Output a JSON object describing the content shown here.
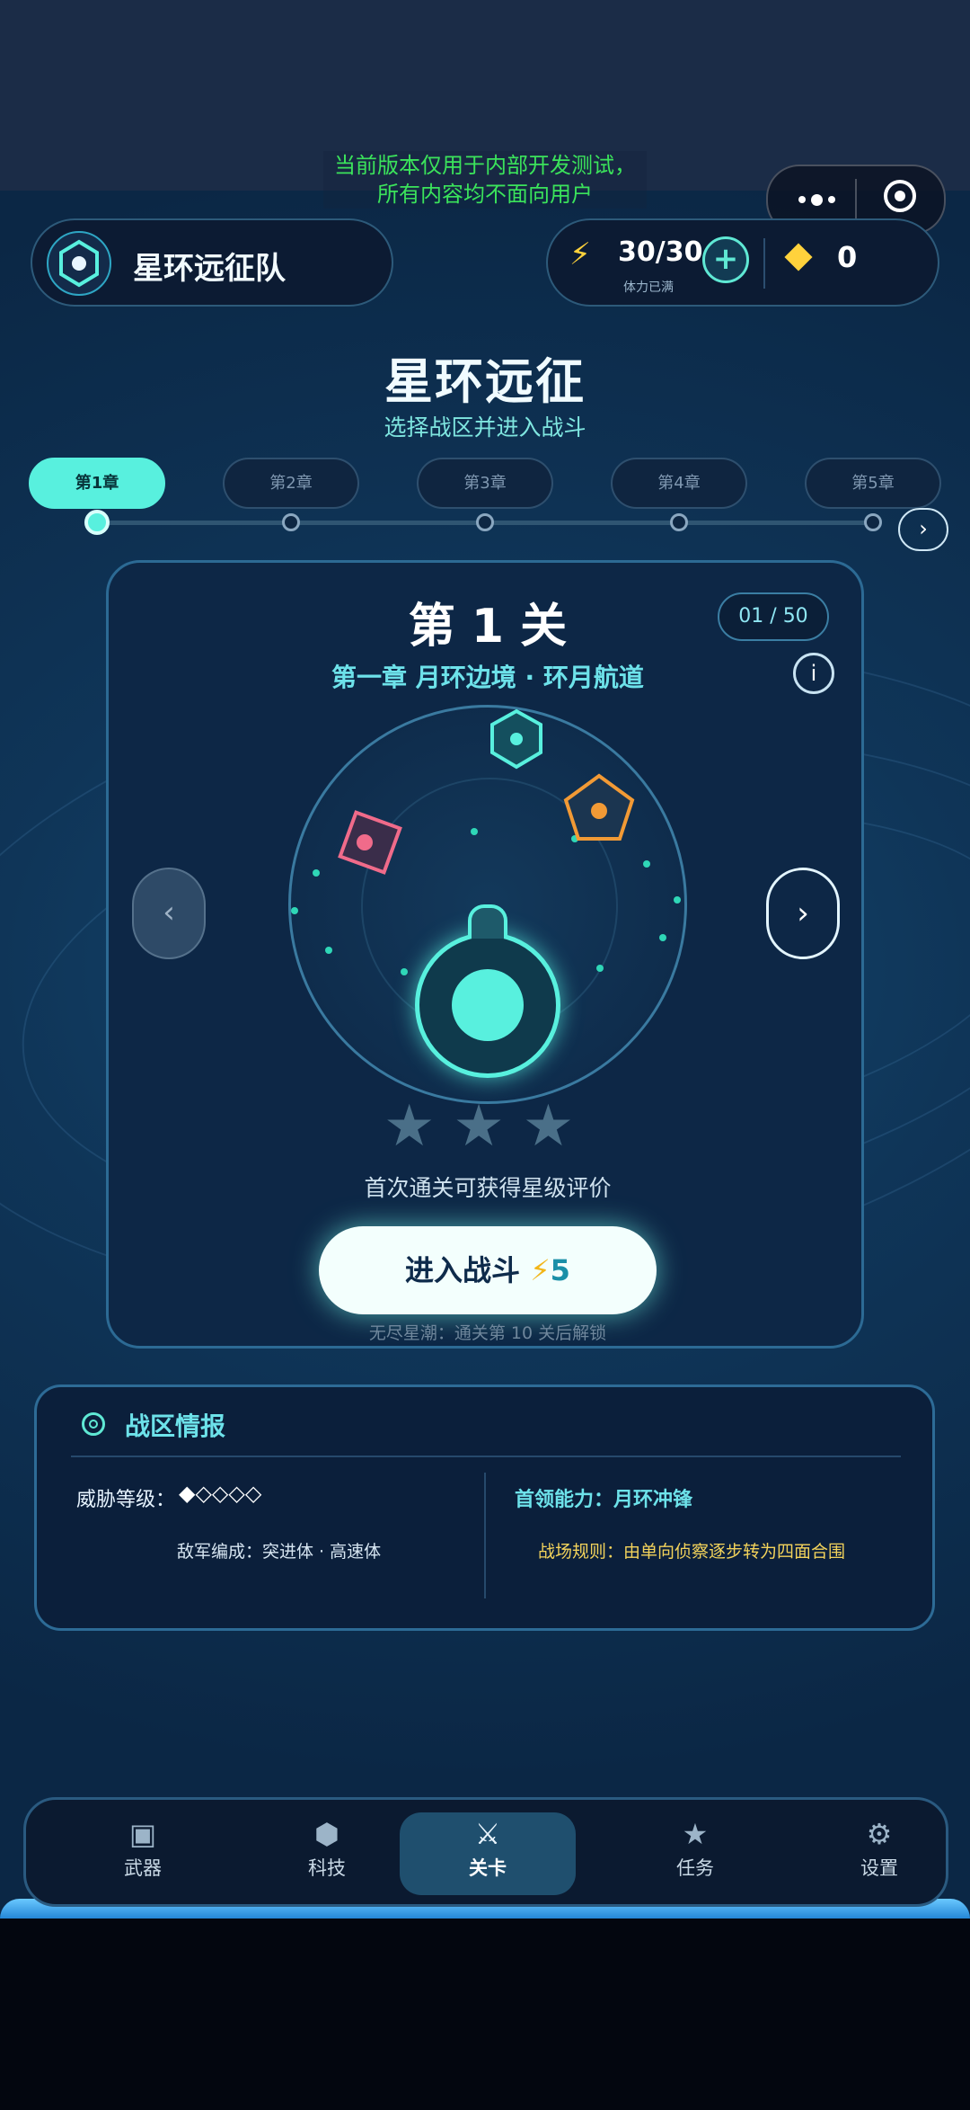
{
  "dev_notice": {
    "line1": "当前版本仅用于内部开发测试，",
    "line2": "所有内容均不面向用户"
  },
  "capsule": {
    "more_icon": "more-dots-icon",
    "close_icon": "target-icon"
  },
  "team": {
    "name": "星环远征队",
    "icon": "hex-badge-icon"
  },
  "resources": {
    "stamina": "30/30",
    "stamina_status": "体力已满",
    "plus_label": "+",
    "gems": "0",
    "colors": {
      "stamina": "#ffd23c",
      "gem": "#ffd23c",
      "accent": "#58f0de"
    }
  },
  "page": {
    "title": "星环远征",
    "subtitle": "选择战区并进入战斗"
  },
  "chapters": [
    {
      "label": "第1章",
      "active": true
    },
    {
      "label": "第2章",
      "active": false
    },
    {
      "label": "第3章",
      "active": false
    },
    {
      "label": "第4章",
      "active": false
    },
    {
      "label": "第5章",
      "active": false
    }
  ],
  "chapter_next": "›",
  "level": {
    "title": "第 1 关",
    "progress": "01 / 50",
    "name": "第一章  月环边境 · 环月航道",
    "info_label": "i",
    "prev_label": "‹",
    "next_label": "›",
    "stars": "★★★",
    "stars_earned": 0,
    "star_hint": "首次通关可获得星级评价",
    "enter_label": "进入战斗",
    "enter_bolt": "⚡",
    "enter_cost": "5",
    "endless_hint": "无尽星潮：通关第 10 关后解锁"
  },
  "intel": {
    "title": "战区情报",
    "threat_label": "威胁等级：",
    "threat_value": "◆◇◇◇◇",
    "enemy": "敌军编成：突进体 · 高速体",
    "boss": "首领能力：月环冲锋",
    "rule": "战场规则：由单向侦察逐步转为四面合围"
  },
  "nav": [
    {
      "label": "武器",
      "icon": "▣",
      "icon_name": "weapon-icon"
    },
    {
      "label": "科技",
      "icon": "⬢",
      "icon_name": "tech-icon"
    },
    {
      "label": "关卡",
      "icon": "⚔",
      "icon_name": "swords-icon",
      "active": true
    },
    {
      "label": "任务",
      "icon": "★",
      "icon_name": "star-icon"
    },
    {
      "label": "设置",
      "icon": "⚙",
      "icon_name": "gear-icon"
    }
  ]
}
